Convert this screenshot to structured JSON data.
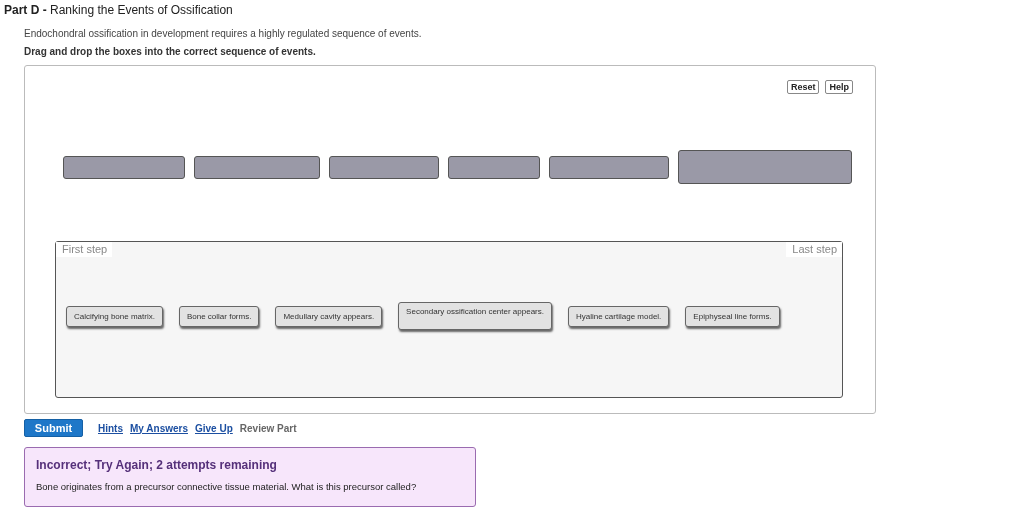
{
  "part": {
    "label": "Part D",
    "separator": "-",
    "title": "Ranking the Events of Ossification"
  },
  "intro": "Endochondral ossification in development requires a highly regulated sequence of events.",
  "instruction": "Drag and drop the boxes into the correct sequence of events.",
  "tools": [
    "Reset",
    "Help"
  ],
  "slots": [
    {
      "filled": false
    },
    {
      "filled": false
    },
    {
      "filled": false
    },
    {
      "filled": false
    },
    {
      "filled": false
    },
    {
      "filled": false
    }
  ],
  "ranking": {
    "first_label": "First step",
    "last_label": "Last step",
    "items": [
      {
        "text": "Calcifying bone matrix.",
        "kind": "normal"
      },
      {
        "text": "Bone collar forms.",
        "kind": "normal"
      },
      {
        "text": "Medullary cavity appears.",
        "kind": "normal"
      },
      {
        "text": "Secondary ossification center appears.",
        "kind": "tall"
      },
      {
        "text": "Hyaline cartilage model.",
        "kind": "normal"
      },
      {
        "text": "Epiphyseal line forms.",
        "kind": "normal"
      }
    ]
  },
  "actions": {
    "submit": "Submit",
    "links": [
      "Hints",
      "My Answers",
      "Give Up"
    ],
    "review": "Review Part"
  },
  "feedback": {
    "title": "Incorrect; Try Again; 2 attempts remaining",
    "message": "Bone originates from a precursor connective tissue material. What is this precursor called?"
  }
}
